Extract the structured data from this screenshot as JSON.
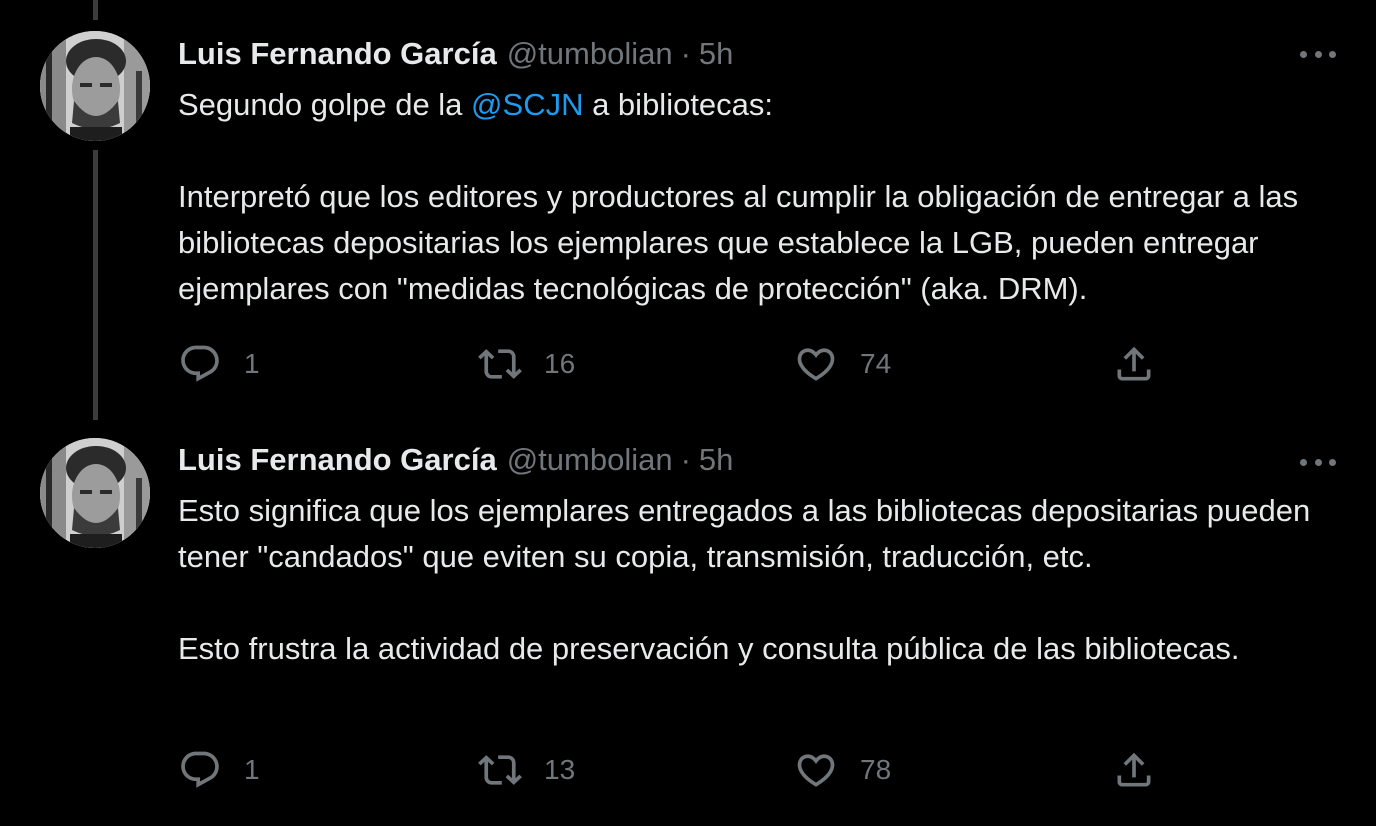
{
  "tweets": [
    {
      "author": {
        "name": "Luis Fernando García",
        "handle": "@tumbolian"
      },
      "separator": "·",
      "time": "5h",
      "text": {
        "line1_before": "Segundo golpe de la ",
        "line1_mention": "@SCJN",
        "line1_after": " a bibliotecas:",
        "para2": "Interpretó que los editores y productores al cumplir la obligación de entregar a las bibliotecas depositarias los ejemplares que establece la LGB, pueden entregar ejemplares con \"medidas tecnológicas de protección\" (aka. DRM)."
      },
      "stats": {
        "replies": "1",
        "retweets": "16",
        "likes": "74"
      }
    },
    {
      "author": {
        "name": "Luis Fernando García",
        "handle": "@tumbolian"
      },
      "separator": "·",
      "time": "5h",
      "text": {
        "para1": "Esto significa que los ejemplares entregados a las bibliotecas depositarias pueden tener \"candados\" que eviten su copia, transmisión, traducción, etc.",
        "para2": "Esto frustra la actividad de preservación y consulta pública de las bibliotecas."
      },
      "stats": {
        "replies": "1",
        "retweets": "13",
        "likes": "78"
      }
    }
  ],
  "icons": {
    "reply": "reply-icon",
    "retweet": "retweet-icon",
    "like": "heart-icon",
    "share": "share-icon",
    "more": "more-icon"
  },
  "colors": {
    "background": "#000000",
    "text": "#e7e9ea",
    "muted": "#71767b",
    "link": "#1d9bf0",
    "thread_line": "#3a3d40"
  }
}
